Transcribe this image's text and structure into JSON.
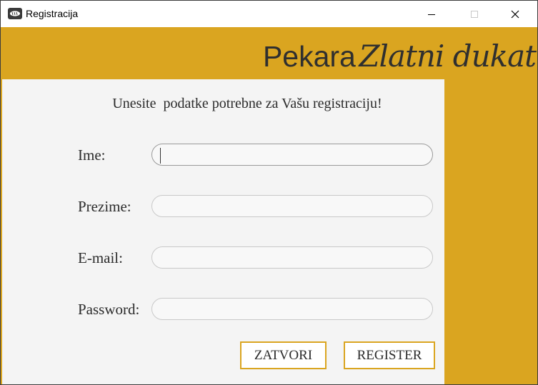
{
  "window": {
    "title": "Registracija",
    "icon": "bread-app-icon",
    "controls": [
      "minimize-icon",
      "maximize-icon",
      "close-icon"
    ]
  },
  "brand": {
    "prefix": "Pekara",
    "name": "Zlatni dukat"
  },
  "form": {
    "heading": "Unesite  podatke potrebne za Vašu registraciju!",
    "fields": [
      {
        "label": "Ime:",
        "value": "",
        "placeholder": ""
      },
      {
        "label": "Prezime:",
        "value": "",
        "placeholder": ""
      },
      {
        "label": "E-mail:",
        "value": "",
        "placeholder": ""
      },
      {
        "label": "Password:",
        "value": "",
        "placeholder": ""
      }
    ],
    "buttons": {
      "close": "ZATVORI",
      "register": "REGISTER"
    }
  },
  "colors": {
    "accent": "#daa520",
    "panel": "#f4f4f4",
    "text": "#2b2b2b"
  }
}
